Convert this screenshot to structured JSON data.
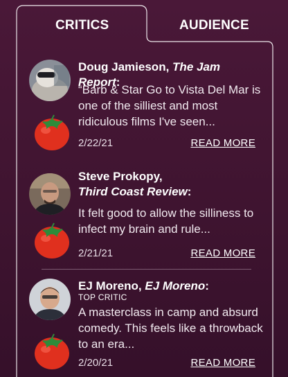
{
  "tabs": {
    "critics": "CRITICS",
    "audience": "AUDIENCE",
    "active": "critics"
  },
  "reviews": [
    {
      "critic": "Doug Jamieson",
      "publication": "The Jam Report",
      "badge": "",
      "quote": "“Barb & Star Go to Vista Del Mar is one of the silliest and most ridiculous films I've seen...",
      "date": "2/22/21",
      "read_more": "READ MORE",
      "rating_icon": "fresh-tomato-icon"
    },
    {
      "critic": "Steve Prokopy",
      "publication": "Third Coast Review",
      "badge": "",
      "quote": "It felt good to allow the silliness to infect my brain and rule...",
      "date": "2/21/21",
      "read_more": "READ MORE",
      "rating_icon": "fresh-tomato-icon"
    },
    {
      "critic": "EJ Moreno",
      "publication": "EJ Moreno",
      "badge": "TOP CRITIC",
      "quote": "A masterclass in camp and absurd comedy. This feels like a throwback to an era...",
      "date": "2/20/21",
      "read_more": "READ MORE",
      "rating_icon": "fresh-tomato-icon"
    }
  ],
  "colors": {
    "background": "#4a1838",
    "tomato": "#e0301e",
    "text": "#ffffff"
  }
}
